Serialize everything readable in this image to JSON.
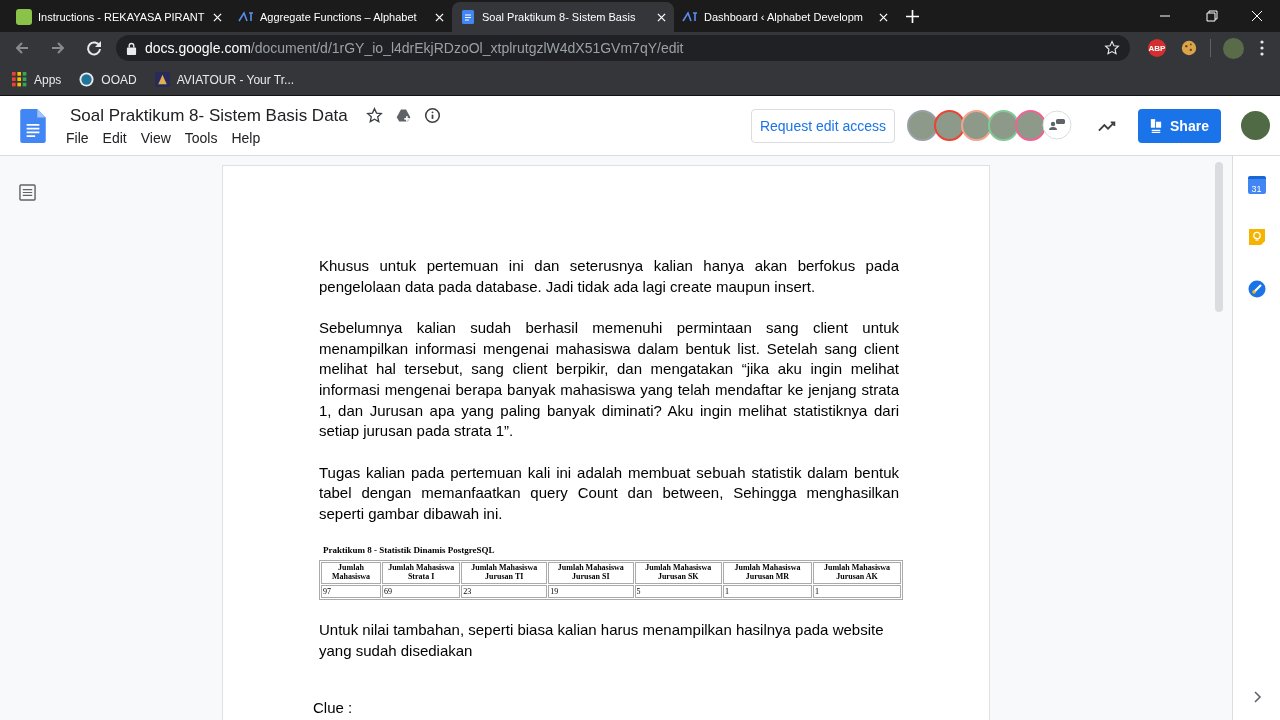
{
  "tabs": [
    {
      "title": "Instructions - REKAYASA PIRANT",
      "kind": "classroom",
      "selected": false
    },
    {
      "title": "Aggregate Functions – Alphabet",
      "kind": "site",
      "selected": false
    },
    {
      "title": "Soal Praktikum 8- Sistem Basis",
      "kind": "doc",
      "selected": true
    },
    {
      "title": "Dashboard ‹ Alphabet Developm",
      "kind": "site",
      "selected": false
    }
  ],
  "address": {
    "host": "docs.google.com",
    "path": "/document/d/1rGY_io_l4drEkjRDzoOl_xtplrutgzlW4dX51GVm7qY/edit"
  },
  "extensions": {
    "abp": "ABP"
  },
  "bookmarks": [
    {
      "label": "Apps",
      "kind": "apps"
    },
    {
      "label": "OOAD",
      "kind": "blog"
    },
    {
      "label": "AVIATOUR - Your Tr...",
      "kind": "travel"
    }
  ],
  "doc": {
    "title": "Soal Praktikum 8- Sistem Basis Data",
    "menu": [
      "File",
      "Edit",
      "View",
      "Tools",
      "Help"
    ],
    "request_access": "Request edit access",
    "share": "Share"
  },
  "collaborators": [
    {
      "color": "#9aa0a6"
    },
    {
      "color": "#ea4335"
    },
    {
      "color": "#f4a48c"
    },
    {
      "color": "#81c995"
    },
    {
      "color": "#f06292"
    }
  ],
  "side_panel": {
    "calendar": "31"
  },
  "paragraphs": [
    "Khusus untuk pertemuan ini dan seterusnya kalian hanya akan berfokus pada pengelolaan data pada database. Jadi tidak ada lagi create maupun insert.",
    "Sebelumnya kalian sudah berhasil memenuhi permintaan sang client untuk menampilkan informasi mengenai mahasiswa dalam bentuk list. Setelah sang client melihat hal tersebut, sang client berpikir, dan mengatakan “jika aku ingin melihat informasi mengenai berapa banyak mahasiswa yang telah mendaftar ke jenjang strata 1, dan Jurusan apa yang paling banyak diminati? Aku ingin melihat statistiknya dari setiap jurusan pada strata 1”.",
    "Tugas kalian pada pertemuan kali ini adalah membuat sebuah statistik dalam bentuk tabel dengan memanfaatkan query Count dan between, Sehingga menghasilkan seperti gambar dibawah ini."
  ],
  "embedded": {
    "title": "Praktikum 8 - Statistik Dinamis PostgreSQL",
    "columns": [
      "Jumlah Mahasiswa",
      "Jumlah Mahasiswa Strata I",
      "Jumlah Mahasiswa Jurusan TI",
      "Jumlah Mahasiswa Jurusan SI",
      "Jumlah Mahasiswa Jurusan SK",
      "Jumlah Mahasiswa Jurusan MR",
      "Jumlah Mahasiswa Jurusan AK"
    ],
    "row": [
      "97",
      "69",
      "23",
      "19",
      "5",
      "1",
      "1"
    ]
  },
  "after": [
    "Untuk nilai tambahan, seperti biasa kalian harus menampilkan hasilnya pada website yang sudah disediakan"
  ],
  "clue": "Clue :"
}
